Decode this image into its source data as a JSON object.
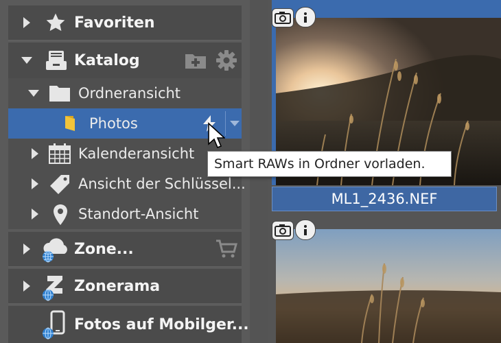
{
  "sidebar": {
    "favoriten": "Favoriten",
    "katalog": "Katalog",
    "ordneransicht": "Ordneransicht",
    "photos": "Photos",
    "kalenderansicht": "Kalenderansicht",
    "schluessel": "Ansicht der Schlüssel...",
    "standort": "Standort-Ansicht",
    "zone": "Zone...",
    "zonerama": "Zonerama",
    "mobil": "Fotos auf Mobilger..."
  },
  "tooltip": "Smart RAWs in Ordner vorladen.",
  "thumbnails": [
    {
      "caption": "ML1_2436.NEF"
    }
  ],
  "colors": {
    "selection": "#3b6bae",
    "sidebar_bg": "#5a5a5a",
    "section_bg": "#4b4b4b"
  }
}
